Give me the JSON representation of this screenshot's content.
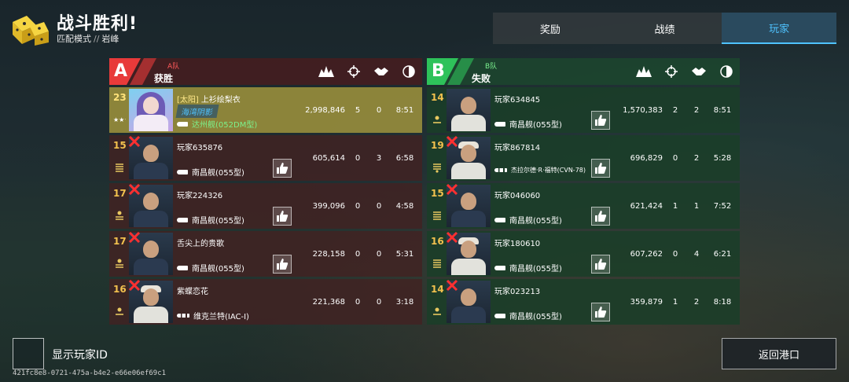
{
  "header": {
    "title": "战斗胜利!",
    "mode": "匹配模式",
    "separator": "//",
    "map": "岩峰",
    "logo_icon": "dice-icon"
  },
  "tabs": [
    {
      "label": "奖励",
      "active": false
    },
    {
      "label": "战绩",
      "active": false
    },
    {
      "label": "玩家",
      "active": true
    }
  ],
  "columns_icons": [
    "damage-icon",
    "kill-crosshair-icon",
    "assist-handshake-icon",
    "survival-time-icon"
  ],
  "team_a": {
    "letter": "A",
    "name": "A队",
    "result": "获胜",
    "color": "#e83a3a",
    "players": [
      {
        "rank": "23",
        "tag": "[太阳]",
        "name": "上衫绘梨衣",
        "guild": "海湾阴影",
        "ship": "达州舰(052DM型)",
        "damage": "2,998,846",
        "kills": "5",
        "assists": "0",
        "time": "8:51",
        "highlight": true,
        "dead": false,
        "avatar": "girl"
      },
      {
        "rank": "15",
        "name": "玩家635876",
        "ship": "南昌舰(055型)",
        "damage": "605,614",
        "kills": "0",
        "assists": "3",
        "time": "6:58",
        "dead": true,
        "avatar": "navy"
      },
      {
        "rank": "17",
        "name": "玩家224326",
        "ship": "南昌舰(055型)",
        "damage": "399,096",
        "kills": "0",
        "assists": "0",
        "time": "4:58",
        "dead": true,
        "avatar": "navy"
      },
      {
        "rank": "17",
        "name": "舌尖上的贵歌",
        "ship": "南昌舰(055型)",
        "damage": "228,158",
        "kills": "0",
        "assists": "0",
        "time": "5:31",
        "dead": true,
        "avatar": "navy"
      },
      {
        "rank": "16",
        "name": "紫蝶恋花",
        "ship": "维克兰特(IAC-I)",
        "damage": "221,368",
        "kills": "0",
        "assists": "0",
        "time": "3:18",
        "dead": true,
        "avatar": "white"
      }
    ]
  },
  "team_b": {
    "letter": "B",
    "name": "B队",
    "result": "失败",
    "color": "#2ec25a",
    "players": [
      {
        "rank": "14",
        "name": "玩家634845",
        "ship": "南昌舰(055型)",
        "damage": "1,570,383",
        "kills": "2",
        "assists": "2",
        "time": "8:51",
        "dead": false,
        "avatar": "white"
      },
      {
        "rank": "19",
        "name": "玩家867814",
        "ship": "杰拉尔德·R·福特(CVN-78)",
        "damage": "696,829",
        "kills": "0",
        "assists": "2",
        "time": "5:28",
        "dead": true,
        "avatar": "white"
      },
      {
        "rank": "15",
        "name": "玩家046060",
        "ship": "南昌舰(055型)",
        "damage": "621,424",
        "kills": "1",
        "assists": "1",
        "time": "7:52",
        "dead": true,
        "avatar": "navy"
      },
      {
        "rank": "16",
        "name": "玩家180610",
        "ship": "南昌舰(055型)",
        "damage": "607,262",
        "kills": "0",
        "assists": "4",
        "time": "6:21",
        "dead": true,
        "avatar": "white"
      },
      {
        "rank": "14",
        "name": "玩家023213",
        "ship": "南昌舰(055型)",
        "damage": "359,879",
        "kills": "1",
        "assists": "2",
        "time": "8:18",
        "dead": true,
        "avatar": "navy"
      }
    ]
  },
  "footer": {
    "show_id_label": "显示玩家ID",
    "match_id": "421fc8e8-0721-475a-b4e2-e66e06ef69c1",
    "back_label": "返回港口"
  }
}
